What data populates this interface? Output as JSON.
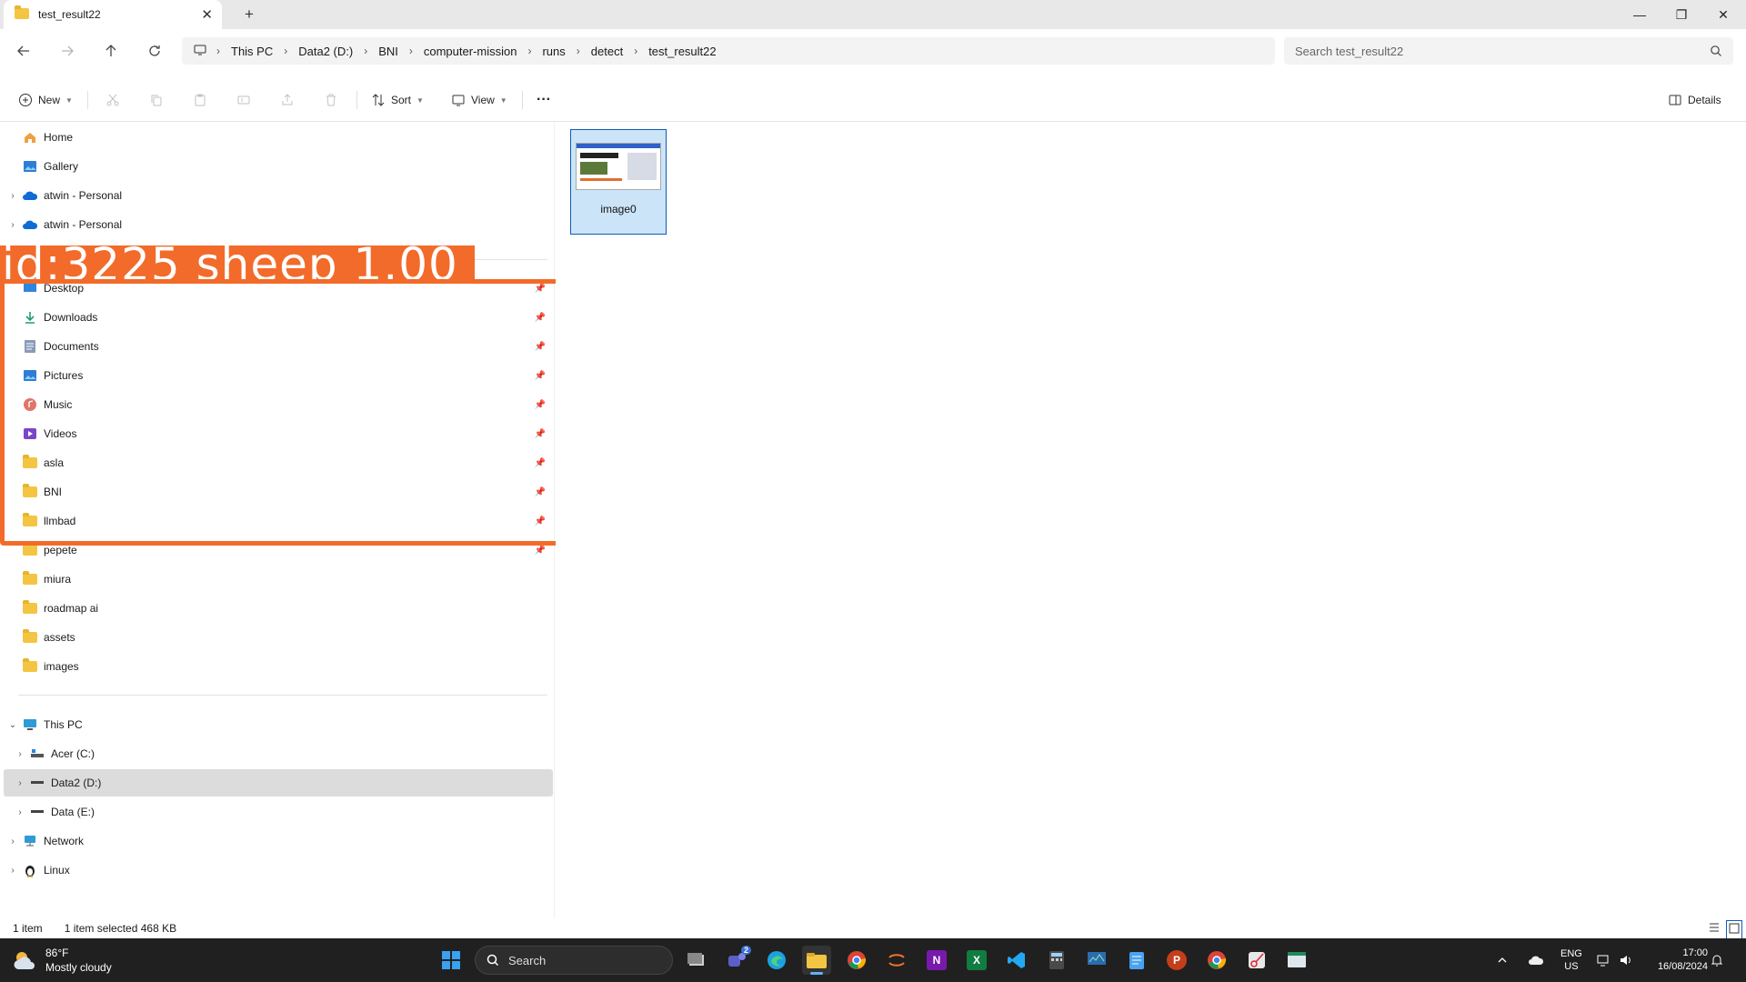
{
  "window": {
    "tab_title": "test_result22",
    "new_tab": "+",
    "minimize": "—",
    "restore": "❐",
    "close": "✕"
  },
  "address": {
    "breadcrumbs": [
      "This PC",
      "Data2 (D:)",
      "BNI",
      "computer-mission",
      "runs",
      "detect",
      "test_result22"
    ],
    "search_placeholder": "Search test_result22"
  },
  "commands": {
    "new_label": "New",
    "sort_label": "Sort",
    "view_label": "View",
    "more_label": "···",
    "details_label": "Details"
  },
  "sidebar": {
    "top_items": [
      {
        "label": "Home",
        "icon": "home-icon"
      },
      {
        "label": "Gallery",
        "icon": "gallery-icon"
      },
      {
        "label": "atwin - Personal",
        "icon": "onedrive-icon"
      },
      {
        "label": "atwin - Personal",
        "icon": "onedrive-icon"
      }
    ],
    "quick_access": [
      {
        "label": "Desktop",
        "icon": "desktop-icon"
      },
      {
        "label": "Downloads",
        "icon": "download-icon"
      },
      {
        "label": "Documents",
        "icon": "documents-icon"
      },
      {
        "label": "Pictures",
        "icon": "pictures-icon"
      },
      {
        "label": "Music",
        "icon": "music-icon"
      },
      {
        "label": "Videos",
        "icon": "videos-icon"
      },
      {
        "label": "asla",
        "icon": "folder-icon"
      },
      {
        "label": "BNI",
        "icon": "folder-icon"
      },
      {
        "label": "llmbad",
        "icon": "folder-icon"
      },
      {
        "label": "pepete",
        "icon": "folder-icon"
      },
      {
        "label": "miura",
        "icon": "folder-icon"
      },
      {
        "label": "roadmap ai",
        "icon": "folder-icon"
      },
      {
        "label": "assets",
        "icon": "folder-icon"
      },
      {
        "label": "images",
        "icon": "folder-icon"
      }
    ],
    "this_pc": {
      "label": "This PC",
      "drives": [
        {
          "label": "Acer (C:)",
          "icon": "drive-c-icon"
        },
        {
          "label": "Data2 (D:)",
          "icon": "drive-icon"
        },
        {
          "label": "Data (E:)",
          "icon": "drive-icon"
        }
      ]
    },
    "network": "Network",
    "linux": "Linux"
  },
  "detection": {
    "label": "id:3225  sheep  1.00",
    "color": "#f26b2a"
  },
  "content": {
    "files": [
      {
        "name": "image0",
        "selected": true
      }
    ]
  },
  "status": {
    "item_count": "1 item",
    "selection": "1 item selected  468 KB"
  },
  "taskbar": {
    "temperature": "86°F",
    "condition": "Mostly cloudy",
    "search_label": "Search",
    "lang_top": "ENG",
    "lang_bottom": "US",
    "time": "17:00",
    "date": "16/08/2024",
    "teams_badge": "2",
    "onenote_letter": "N",
    "excel_letter": "X",
    "powerpoint_letter": "P"
  },
  "colors": {
    "accent": "#0f5bb5",
    "selection_fill": "#cce4f7",
    "taskbar": "#202020"
  }
}
